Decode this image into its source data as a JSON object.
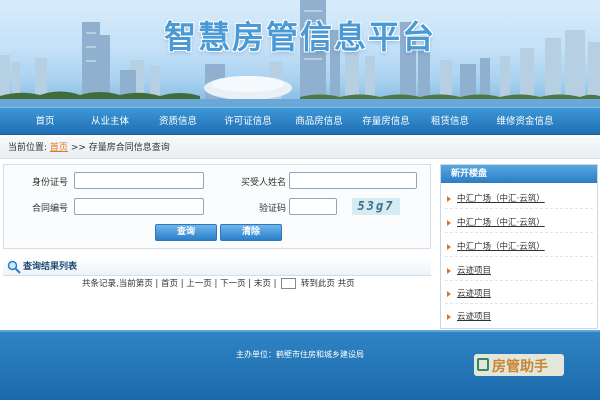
{
  "banner": {
    "title": "智慧房管信息平台"
  },
  "nav": {
    "items": [
      "首页",
      "从业主体",
      "资质信息",
      "许可证信息",
      "商品房信息",
      "存量房信息",
      "租赁信息",
      "维修资金信息"
    ]
  },
  "breadcrumb": {
    "prefix": "当前位置:",
    "home": "首页",
    "separator": ">>",
    "current": "存量房合同信息查询"
  },
  "form": {
    "id_label": "身份证号",
    "buyer_label": "买受人姓名",
    "contract_label": "合同编号",
    "captcha_label": "验证码",
    "id_value": "",
    "buyer_value": "",
    "contract_value": "",
    "captcha_value": "",
    "captcha_image_text": "53g7",
    "query_button": "查询",
    "clear_button": "清除"
  },
  "results": {
    "title": "查询结果列表",
    "pager_info": "共条记录,当前第页",
    "first": "首页",
    "prev": "上一页",
    "next": "下一页",
    "last": "末页",
    "goto": "转到此页",
    "total_pages": "共页",
    "sep": "|"
  },
  "sidebar": {
    "title": "新开楼盘",
    "items": [
      "中汇广场（中汇·云筑）",
      "中汇广场（中汇·云筑）",
      "中汇广场（中汇·云筑）",
      "云迹项目",
      "云迹项目",
      "云迹项目"
    ]
  },
  "footer": {
    "sponsor": "主办单位：鹤壁市住房和城乡建设局"
  },
  "watermark": {
    "text": "房管助手"
  },
  "colors": {
    "nav_bg": "#2f84c4",
    "accent_orange": "#e07a18",
    "title_blue": "#4a9ad6"
  }
}
